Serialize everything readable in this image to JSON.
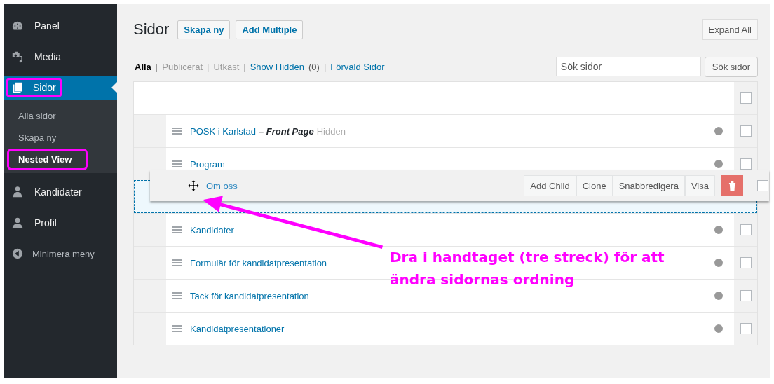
{
  "sidebar": {
    "items": [
      {
        "label": "Panel",
        "kind": "gauge",
        "selected": false,
        "highlighted": false
      },
      {
        "label": "Media",
        "kind": "media",
        "selected": false,
        "highlighted": false
      },
      {
        "label": "Sidor",
        "kind": "pages",
        "selected": true,
        "highlighted": true,
        "children": [
          {
            "label": "Alla sidor",
            "selected": false,
            "highlighted": false
          },
          {
            "label": "Skapa ny",
            "selected": false,
            "highlighted": false
          },
          {
            "label": "Nested View",
            "selected": true,
            "highlighted": true
          }
        ]
      },
      {
        "label": "Kandidater",
        "kind": "person-tie",
        "selected": false,
        "highlighted": false
      },
      {
        "label": "Profil",
        "kind": "person",
        "selected": false,
        "highlighted": false
      }
    ],
    "collapse": {
      "label": "Minimera meny"
    }
  },
  "header": {
    "title": "Sidor",
    "buttons": [
      "Skapa ny",
      "Add Multiple"
    ],
    "expand_button": "Expand All"
  },
  "filters": [
    {
      "label": "Alla",
      "kind": "current"
    },
    {
      "separator": "|",
      "label": "Publicerat",
      "kind": "muted"
    },
    {
      "separator": "|",
      "label": "Utkast",
      "kind": "muted"
    },
    {
      "separator": "|",
      "label": "Show Hidden",
      "kind": "link",
      "count": "(0)"
    },
    {
      "separator": "|",
      "label": "Förvald Sidor",
      "kind": "link"
    }
  ],
  "search": {
    "placeholder": "Sök sidor",
    "button": "Sök sidor"
  },
  "table": {
    "header_checkbox": {
      "checked": false
    },
    "rows": [
      {
        "kind": "page",
        "title": "POSK i Karlstad",
        "state_label": "– Front Page",
        "hidden_label": "Hidden",
        "checked": false
      },
      {
        "kind": "page",
        "title": "Program",
        "checked": false
      },
      {
        "kind": "placeholder"
      },
      {
        "kind": "page",
        "title": "Kandidater",
        "checked": false
      },
      {
        "kind": "page",
        "title": "Formulär för kandidatpresentation",
        "checked": false
      },
      {
        "kind": "page",
        "title": "Tack för kandidatpresentation",
        "checked": false
      },
      {
        "kind": "page",
        "title": "Kandidatpresentationer",
        "checked": false
      }
    ]
  },
  "dragged_row": {
    "title": "Om oss",
    "actions": [
      "Add Child",
      "Clone",
      "Snabbredigera",
      "Visa"
    ],
    "checked": false
  },
  "annotation": {
    "lines": [
      "Dra i handtaget (tre streck) för att",
      "ändra sidornas ordning"
    ]
  }
}
